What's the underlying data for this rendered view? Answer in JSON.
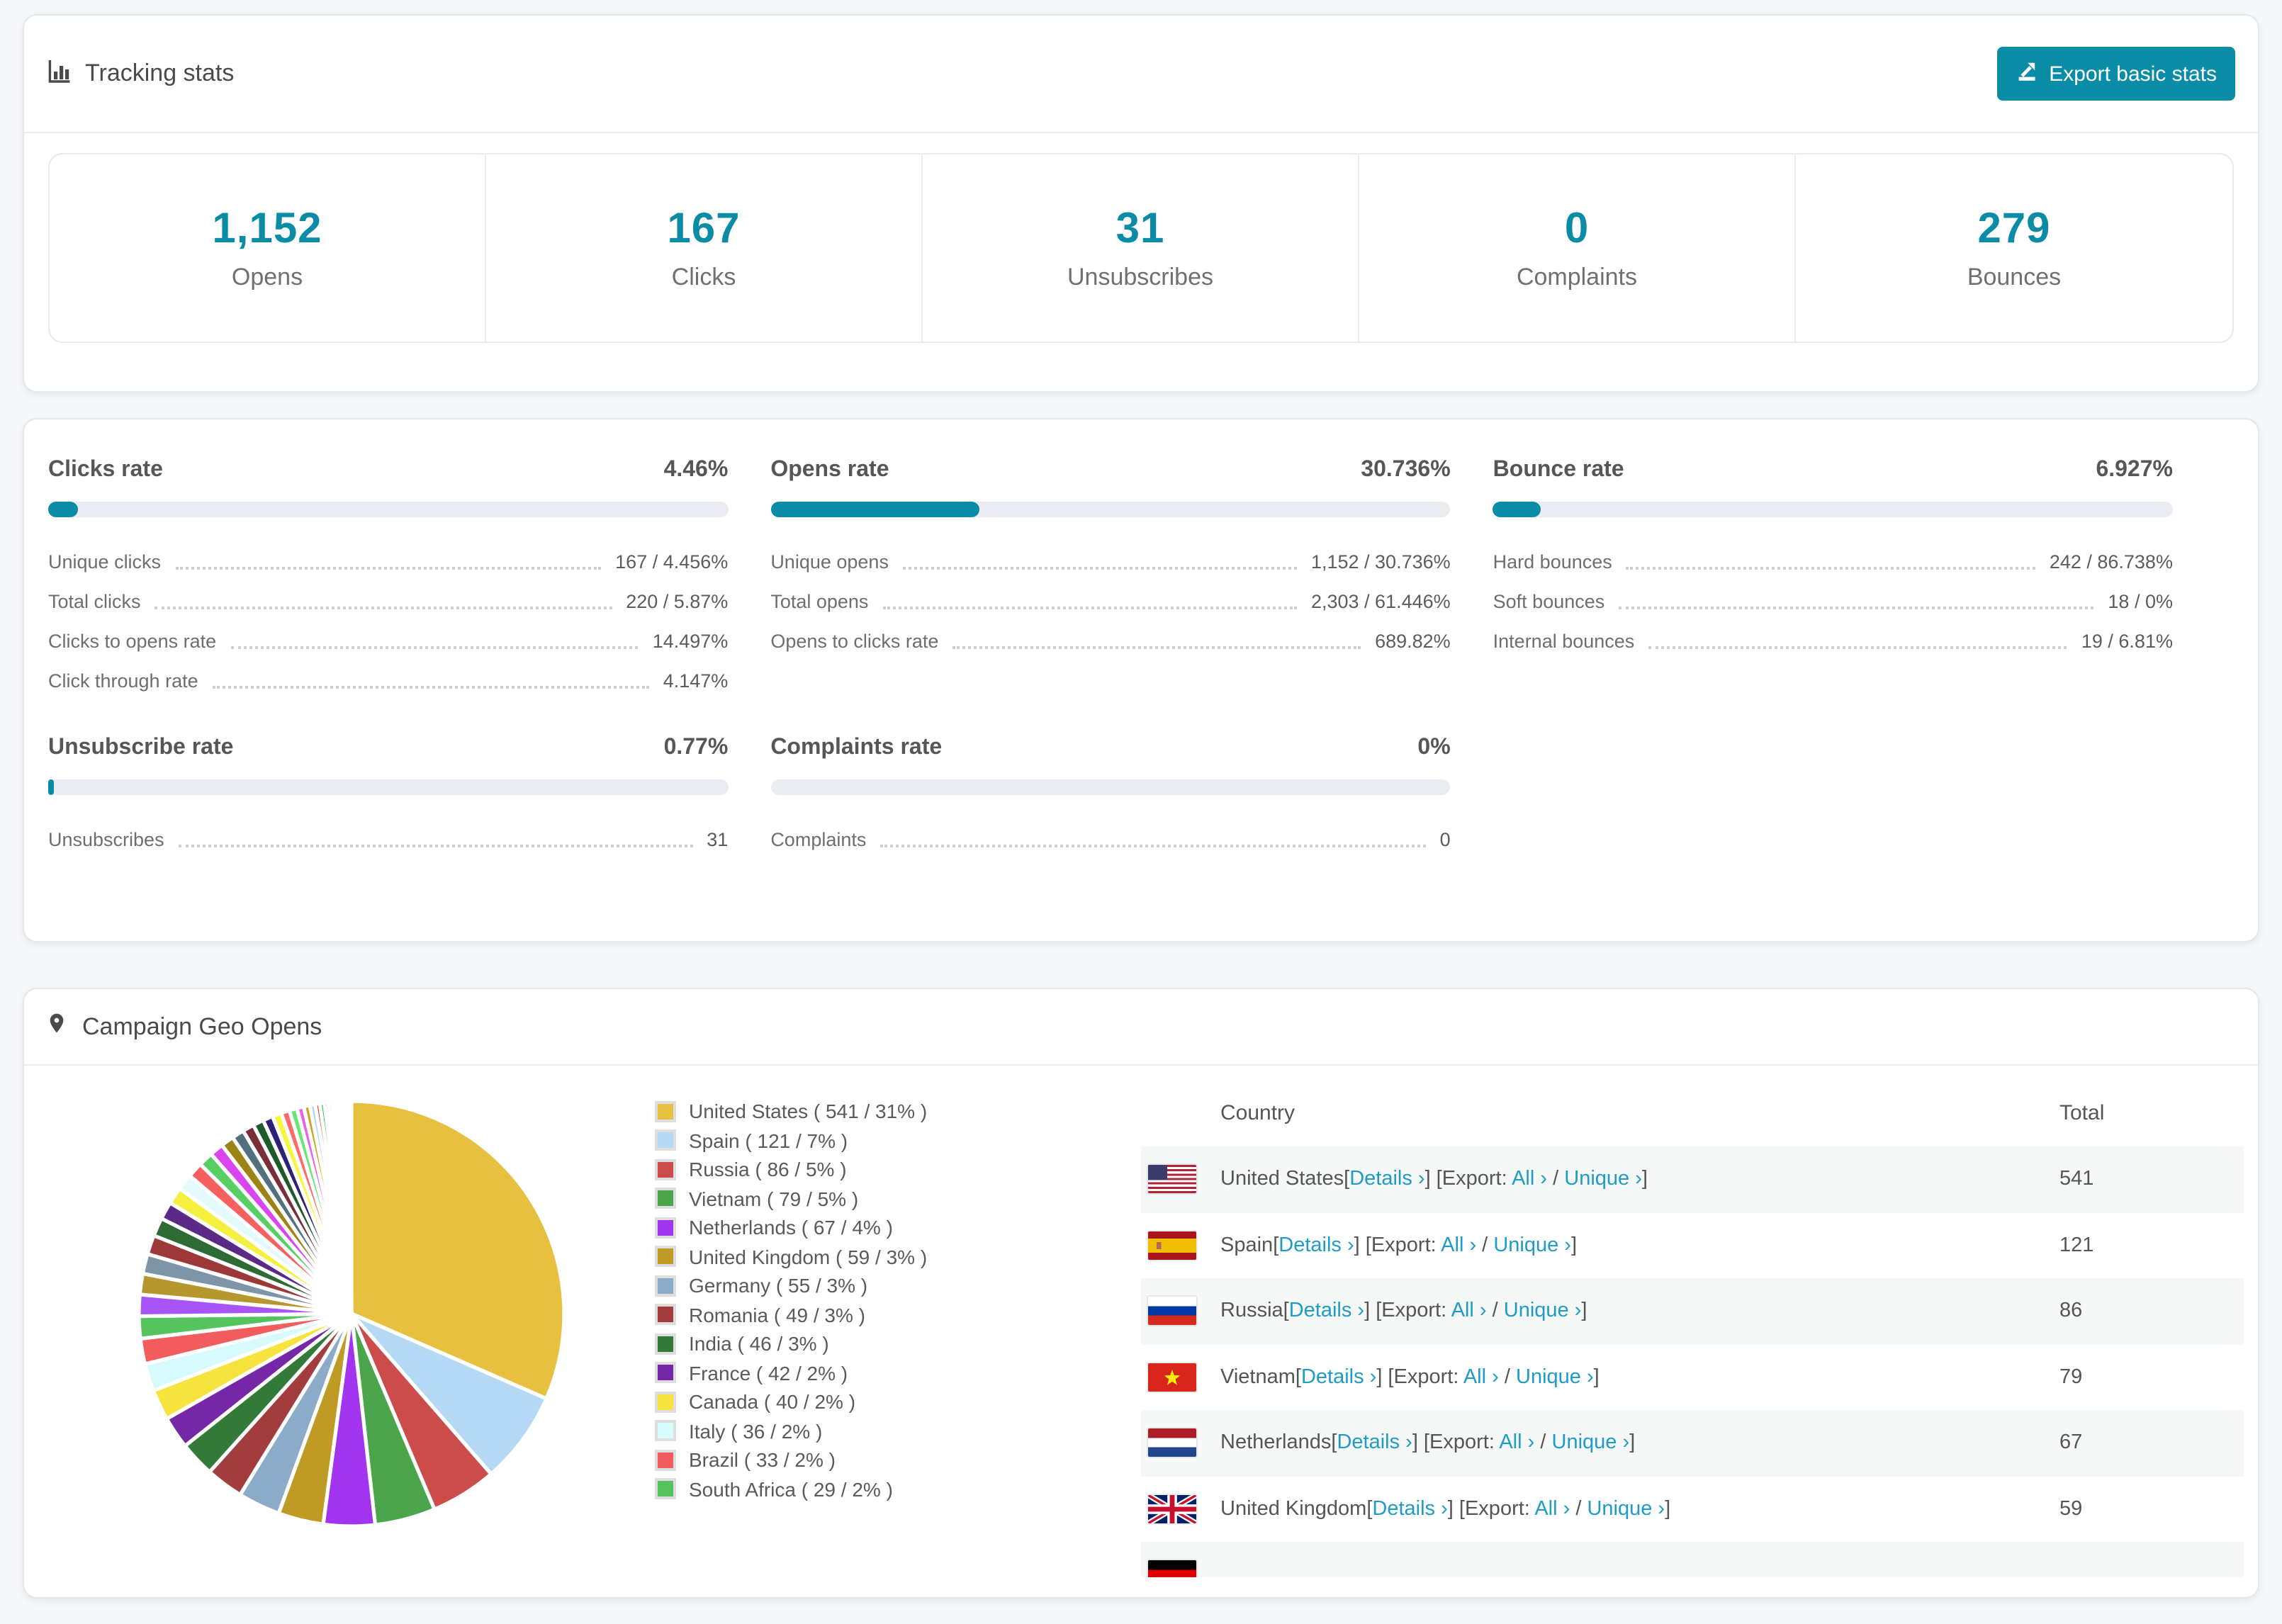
{
  "colors": {
    "accent_teal": "#0b8ca6",
    "link_teal": "#1e9cc5",
    "bar_track": "#e9ecf0"
  },
  "tracking": {
    "title": "Tracking stats",
    "export_button": "Export basic stats",
    "summary": [
      {
        "value": "1,152",
        "label": "Opens"
      },
      {
        "value": "167",
        "label": "Clicks"
      },
      {
        "value": "31",
        "label": "Unsubscribes"
      },
      {
        "value": "0",
        "label": "Complaints"
      },
      {
        "value": "279",
        "label": "Bounces"
      }
    ]
  },
  "rates": {
    "clicks": {
      "title": "Clicks rate",
      "value": "4.46%",
      "percent": 4.46,
      "rows": [
        {
          "label": "Unique clicks",
          "value": "167 / 4.456%"
        },
        {
          "label": "Total clicks",
          "value": "220 / 5.87%"
        },
        {
          "label": "Clicks to opens rate",
          "value": "14.497%"
        },
        {
          "label": "Click through rate",
          "value": "4.147%"
        }
      ]
    },
    "opens": {
      "title": "Opens rate",
      "value": "30.736%",
      "percent": 30.736,
      "rows": [
        {
          "label": "Unique opens",
          "value": "1,152 / 30.736%"
        },
        {
          "label": "Total opens",
          "value": "2,303 / 61.446%"
        },
        {
          "label": "Opens to clicks rate",
          "value": "689.82%"
        }
      ]
    },
    "bounce": {
      "title": "Bounce rate",
      "value": "6.927%",
      "percent": 6.927,
      "rows": [
        {
          "label": "Hard bounces",
          "value": "242 / 86.738%"
        },
        {
          "label": "Soft bounces",
          "value": "18 / 0%"
        },
        {
          "label": "Internal bounces",
          "value": "19 / 6.81%"
        }
      ]
    },
    "unsubscribe": {
      "title": "Unsubscribe rate",
      "value": "0.77%",
      "percent": 0.77,
      "rows": [
        {
          "label": "Unsubscribes",
          "value": "31"
        }
      ]
    },
    "complaints": {
      "title": "Complaints rate",
      "value": "0%",
      "percent": 0,
      "rows": [
        {
          "label": "Complaints",
          "value": "0"
        }
      ]
    }
  },
  "geo": {
    "title": "Campaign Geo Opens",
    "legend": [
      {
        "label": "United States ( 541 / 31% )",
        "color": "#e8c03f"
      },
      {
        "label": "Spain ( 121 / 7% )",
        "color": "#b5d9f5"
      },
      {
        "label": "Russia ( 86 / 5% )",
        "color": "#cc4b4b"
      },
      {
        "label": "Vietnam ( 79 / 5% )",
        "color": "#4ba64b"
      },
      {
        "label": "Netherlands ( 67 / 4% )",
        "color": "#a234f0"
      },
      {
        "label": "United Kingdom ( 59 / 3% )",
        "color": "#bf9b26"
      },
      {
        "label": "Germany ( 55 / 3% )",
        "color": "#8cabc9"
      },
      {
        "label": "Romania ( 49 / 3% )",
        "color": "#a33c3c"
      },
      {
        "label": "India ( 46 / 3% )",
        "color": "#337a38"
      },
      {
        "label": "France ( 42 / 2% )",
        "color": "#7527a8"
      },
      {
        "label": "Canada ( 40 / 2% )",
        "color": "#f7e33e"
      },
      {
        "label": "Italy ( 36 / 2% )",
        "color": "#d7fbfc"
      },
      {
        "label": "Brazil ( 33 / 2% )",
        "color": "#f25c5c"
      },
      {
        "label": "South Africa ( 29 / 2% )",
        "color": "#55c45e"
      }
    ],
    "table": {
      "headers": [
        "Country",
        "Total"
      ],
      "link_labels": {
        "details": "Details ›",
        "export_prefix": "Export:",
        "all": "All ›",
        "unique": "Unique ›"
      },
      "rows": [
        {
          "flag": "us",
          "country": "United States",
          "total": "541"
        },
        {
          "flag": "es",
          "country": "Spain",
          "total": "121"
        },
        {
          "flag": "ru",
          "country": "Russia",
          "total": "86"
        },
        {
          "flag": "vn",
          "country": "Vietnam",
          "total": "79"
        },
        {
          "flag": "nl",
          "country": "Netherlands",
          "total": "67"
        },
        {
          "flag": "gb",
          "country": "United Kingdom",
          "total": "59"
        },
        {
          "flag": "de",
          "country": "",
          "total": ""
        }
      ]
    },
    "chart_data": {
      "type": "pie",
      "title": "Campaign Geo Opens",
      "legend_position": "right",
      "start_angle_deg": -90,
      "direction": "clockwise",
      "series": [
        {
          "name": "United States",
          "value": 541,
          "pct": 31,
          "color": "#e8c03f"
        },
        {
          "name": "Spain",
          "value": 121,
          "pct": 7,
          "color": "#b5d9f5"
        },
        {
          "name": "Russia",
          "value": 86,
          "pct": 5,
          "color": "#cc4b4b"
        },
        {
          "name": "Vietnam",
          "value": 79,
          "pct": 5,
          "color": "#4ba64b"
        },
        {
          "name": "Netherlands",
          "value": 67,
          "pct": 4,
          "color": "#a234f0"
        },
        {
          "name": "United Kingdom",
          "value": 59,
          "pct": 3,
          "color": "#bf9b26"
        },
        {
          "name": "Germany",
          "value": 55,
          "pct": 3,
          "color": "#8cabc9"
        },
        {
          "name": "Romania",
          "value": 49,
          "pct": 3,
          "color": "#a33c3c"
        },
        {
          "name": "India",
          "value": 46,
          "pct": 3,
          "color": "#337a38"
        },
        {
          "name": "France",
          "value": 42,
          "pct": 2,
          "color": "#7527a8"
        },
        {
          "name": "Canada",
          "value": 40,
          "pct": 2,
          "color": "#f7e33e"
        },
        {
          "name": "Italy",
          "value": 36,
          "pct": 2,
          "color": "#d7fbfc"
        },
        {
          "name": "Brazil",
          "value": 33,
          "pct": 2,
          "color": "#f25c5c"
        },
        {
          "name": "South Africa",
          "value": 29,
          "pct": 2,
          "color": "#55c45e"
        }
      ],
      "unlabeled_remainder": {
        "values": [
          28,
          27,
          26,
          25,
          24,
          23,
          22,
          21,
          20,
          19,
          18,
          17,
          16,
          15,
          14,
          13,
          12,
          11,
          10,
          9,
          8,
          7,
          6,
          6,
          5,
          5,
          4,
          4,
          3,
          3,
          2,
          2,
          2,
          1,
          1,
          1,
          1,
          1
        ],
        "palette": [
          "#a855f7",
          "#b8962e",
          "#7e94a9",
          "#9c3838",
          "#2e6b34",
          "#5b2a86",
          "#f5ef3e",
          "#e3fbfc",
          "#f86060",
          "#57cf63",
          "#d946ef",
          "#9c8414",
          "#53707f",
          "#7c2d3a",
          "#1d5b2a",
          "#2d2178",
          "#f7f73e",
          "#ff6b6b",
          "#66e673",
          "#ea5fe6",
          "#cfa31f",
          "#a8d8f5",
          "#e33b3b",
          "#41bd4f",
          "#8a2be2",
          "#caa92d",
          "#90cdf4",
          "#f27272",
          "#4ade80",
          "#e879f9",
          "#d4af37",
          "#bfdcf7",
          "#ef4444",
          "#4caf50",
          "#9f5af0",
          "#d6b429",
          "#aacfe8",
          "#f08080"
        ]
      }
    }
  }
}
